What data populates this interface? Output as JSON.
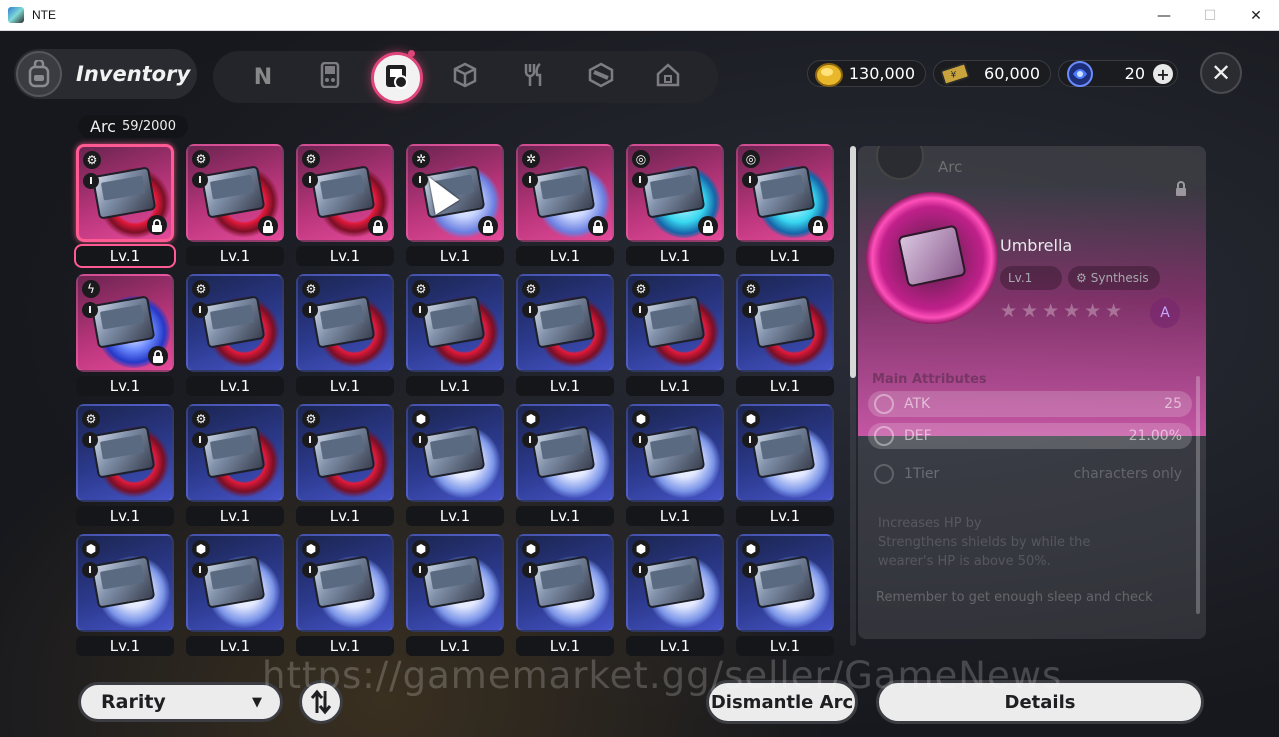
{
  "window": {
    "title": "NTE",
    "minimize": "—",
    "maximize": "☐",
    "close": "✕"
  },
  "header": {
    "section_title": "Inventory",
    "section_icon": "backpack-icon",
    "tabs": [
      {
        "icon": "n-logo-icon",
        "glyph": "N",
        "active": false
      },
      {
        "icon": "handheld-device-icon",
        "glyph": "▯",
        "active": false
      },
      {
        "icon": "arc-device-icon",
        "glyph": "◙",
        "active": true
      },
      {
        "icon": "cube-icon",
        "glyph": "⬡",
        "active": false
      },
      {
        "icon": "fork-knife-icon",
        "glyph": "🍴",
        "active": false
      },
      {
        "icon": "box-tape-icon",
        "glyph": "⬢",
        "active": false
      },
      {
        "icon": "home-icon",
        "glyph": "⌂",
        "active": false
      }
    ],
    "currencies": [
      {
        "icon": "gold-coin-icon",
        "value": "130,000",
        "color": "#e8b82a"
      },
      {
        "icon": "gold-ticket-icon",
        "value": "60,000",
        "color": "#c9a33c"
      },
      {
        "icon": "blue-crystal-icon",
        "value": "20",
        "color": "#4a7bff",
        "add": "+"
      }
    ],
    "close_label": "✕"
  },
  "inventory": {
    "category_label": "Arc",
    "count": "59/2000",
    "level_label": "Lv.1",
    "tier_label": "I",
    "rows": [
      [
        {
          "rarity": "pink",
          "type_icon": "gear-icon",
          "glow": "red",
          "locked": true,
          "selected": true
        },
        {
          "rarity": "pink",
          "type_icon": "gear-icon",
          "glow": "red",
          "locked": true
        },
        {
          "rarity": "pink",
          "type_icon": "gear-icon",
          "glow": "red",
          "locked": true
        },
        {
          "rarity": "pink",
          "type_icon": "swirl-icon",
          "glow": "white",
          "locked": true,
          "highlighted": true
        },
        {
          "rarity": "pink",
          "type_icon": "swirl-icon",
          "glow": "white",
          "locked": true
        },
        {
          "rarity": "pink",
          "type_icon": "spiral-icon",
          "glow": "cyan",
          "locked": true
        },
        {
          "rarity": "pink",
          "type_icon": "spiral-icon",
          "glow": "cyan",
          "locked": true
        }
      ],
      [
        {
          "rarity": "pink",
          "type_icon": "lightning-icon",
          "glow": "storm",
          "locked": true
        },
        {
          "rarity": "blue",
          "type_icon": "gear-icon",
          "glow": "red",
          "locked": false
        },
        {
          "rarity": "blue",
          "type_icon": "gear-icon",
          "glow": "red",
          "locked": false
        },
        {
          "rarity": "blue",
          "type_icon": "gear-icon",
          "glow": "red",
          "locked": false
        },
        {
          "rarity": "blue",
          "type_icon": "gear-icon",
          "glow": "red",
          "locked": false
        },
        {
          "rarity": "blue",
          "type_icon": "gear-icon",
          "glow": "red",
          "locked": false
        },
        {
          "rarity": "blue",
          "type_icon": "gear-icon",
          "glow": "red",
          "locked": false
        }
      ],
      [
        {
          "rarity": "blue",
          "type_icon": "gear-icon",
          "glow": "red",
          "locked": false
        },
        {
          "rarity": "blue",
          "type_icon": "gear-icon",
          "glow": "red",
          "locked": false
        },
        {
          "rarity": "blue",
          "type_icon": "gear-icon",
          "glow": "red",
          "locked": false
        },
        {
          "rarity": "blue",
          "type_icon": "cube-icon",
          "glow": "moon",
          "locked": false
        },
        {
          "rarity": "blue",
          "type_icon": "cube-icon",
          "glow": "moon",
          "locked": false
        },
        {
          "rarity": "blue",
          "type_icon": "cube-icon",
          "glow": "moon",
          "locked": false
        },
        {
          "rarity": "blue",
          "type_icon": "cube-icon",
          "glow": "moon",
          "locked": false
        }
      ],
      [
        {
          "rarity": "blue",
          "type_icon": "cube-icon",
          "glow": "moon",
          "locked": false
        },
        {
          "rarity": "blue",
          "type_icon": "cube-icon",
          "glow": "moon",
          "locked": false
        },
        {
          "rarity": "blue",
          "type_icon": "cube-icon",
          "glow": "moon",
          "locked": false
        },
        {
          "rarity": "blue",
          "type_icon": "cube-icon",
          "glow": "moon",
          "locked": false
        },
        {
          "rarity": "blue",
          "type_icon": "cube-icon",
          "glow": "moon",
          "locked": false
        },
        {
          "rarity": "blue",
          "type_icon": "cube-icon",
          "glow": "moon",
          "locked": false
        },
        {
          "rarity": "blue",
          "type_icon": "cube-icon",
          "glow": "moon",
          "locked": false
        }
      ]
    ]
  },
  "detail": {
    "type_label": "Arc",
    "name": "Umbrella",
    "level": "Lv.1",
    "synthesis_label": "Synthesis",
    "stars": "★★★★★★",
    "badge_glyph": "A",
    "attributes_title": "Main Attributes",
    "attributes": [
      {
        "name": "ATK",
        "value": "25",
        "icon": "sword-icon"
      },
      {
        "name": "DEF",
        "value": "21.00%",
        "icon": "shield-icon"
      }
    ],
    "tier": {
      "label": "1Tier",
      "note": "characters only"
    },
    "description": [
      "Increases HP by",
      "Strengthens shields by          while the",
      "wearer's HP is above 50%."
    ],
    "quote": "Remember to get enough sleep and check"
  },
  "footer": {
    "rarity_label": "Rarity",
    "sort_icon": "sort-arrows-icon",
    "dismantle_label": "Dismantle Arc",
    "details_label": "Details"
  },
  "watermark": "https://gamemarket.gg/seller/GameNews",
  "colors": {
    "accent": "#e0457a",
    "rarity_pink": "#b8357a",
    "rarity_blue": "#2c3a8e",
    "button_bg": "#ececec"
  }
}
